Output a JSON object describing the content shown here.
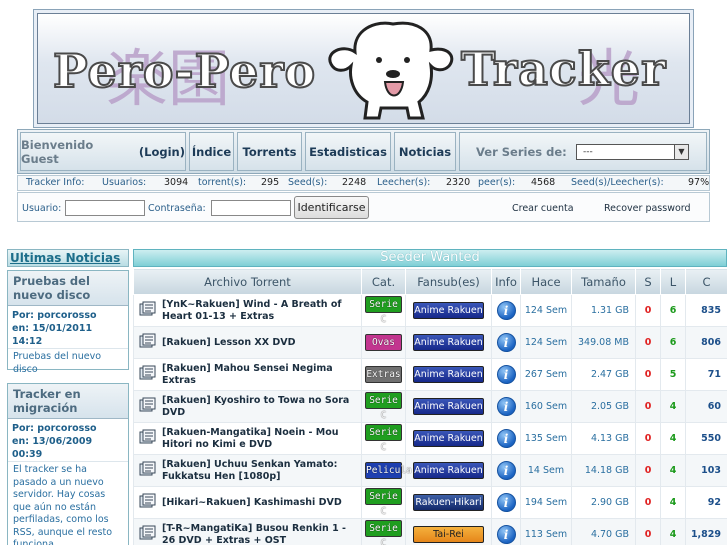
{
  "banner": {
    "word_left": "Pero-Pero",
    "word_right": "Tracker",
    "kanji_left": "楽園",
    "kanji_right": "光"
  },
  "nav": {
    "welcome": "Bienvenido Guest",
    "login_link": "(Login)",
    "items": [
      "Índice",
      "Torrents",
      "Estadisticas",
      "Noticias"
    ],
    "series_label": "Ver Series de:",
    "series_value": "---"
  },
  "stats": {
    "tracker_info": "Tracker Info:",
    "users_label": "Usuarios:",
    "users": "3094",
    "torrents_label": "torrent(s):",
    "torrents": "295",
    "seeds_label": "Seed(s):",
    "seeds": "2248",
    "leechers_label": "Leecher(s):",
    "leechers": "2320",
    "peers_label": "peer(s):",
    "peers": "4568",
    "ratio_label": "Seed(s)/Leecher(s):",
    "ratio": "97%"
  },
  "login": {
    "user_label": "Usuario:",
    "pass_label": "Contraseña:",
    "submit": "Identificarse",
    "create_account": "Crear cuenta",
    "recover": "Recover password"
  },
  "sidebar": {
    "title": "Ultimas Noticias",
    "news": [
      {
        "title": "Pruebas del nuevo disco",
        "author": "Por: porcorosso",
        "date": "en: 15/01/2011 14:12",
        "body": "Pruebas del nuevo disco"
      },
      {
        "title": "Tracker en migración",
        "author": "Por: porcorosso",
        "date": "en: 13/06/2009 00:39",
        "body": "El tracker se ha pasado a un nuevo servidor. Hay cosas que aún no están perfiladas, como los RSS, aunque el resto funciona."
      }
    ]
  },
  "main": {
    "title": "Seeder Wanted",
    "columns": [
      "Archivo Torrent",
      "Cat.",
      "Fansub(es)",
      "Info",
      "Hace",
      "Tamaño",
      "S",
      "L",
      "C"
    ],
    "rows": [
      {
        "name": "[YnK~Rakuen] Wind - A Breath of Heart 01-13 + Extras",
        "cat": "Serie C",
        "cat_color": "#1f9e1f",
        "fansub": "Anime Rakuen",
        "fansub_style": "rakuen",
        "hace": "124 Sem",
        "size": "1.31 GB",
        "s": "0",
        "l": "6",
        "c": "835"
      },
      {
        "name": "[Rakuen] Lesson XX DVD",
        "cat": "Ovas",
        "cat_color": "#c2358f",
        "fansub": "Anime Rakuen",
        "fansub_style": "rakuen",
        "hace": "124 Sem",
        "size": "349.08 MB",
        "s": "0",
        "l": "6",
        "c": "806"
      },
      {
        "name": "[Rakuen] Mahou Sensei Negima Extras",
        "cat": "Extras",
        "cat_color": "#707070",
        "fansub": "Anime Rakuen",
        "fansub_style": "rakuen",
        "hace": "267 Sem",
        "size": "2.47 GB",
        "s": "0",
        "l": "5",
        "c": "71"
      },
      {
        "name": "[Rakuen] Kyoshiro to Towa no Sora DVD",
        "cat": "Serie C",
        "cat_color": "#1f9e1f",
        "fansub": "Anime Rakuen",
        "fansub_style": "rakuen",
        "hace": "160 Sem",
        "size": "2.05 GB",
        "s": "0",
        "l": "4",
        "c": "60"
      },
      {
        "name": "[Rakuen-Mangatika] Noein - Mou Hitori no Kimi e DVD",
        "cat": "Serie C",
        "cat_color": "#1f9e1f",
        "fansub": "Anime Rakuen",
        "fansub_style": "rakuen",
        "hace": "135 Sem",
        "size": "4.13 GB",
        "s": "0",
        "l": "4",
        "c": "550"
      },
      {
        "name": "[Rakuen] Uchuu Senkan Yamato: Fukkatsu Hen [1080p]",
        "cat": "Pelicula",
        "cat_color": "#1e3fb0",
        "fansub": "Anime Rakuen",
        "fansub_style": "rakuen",
        "hace": "14 Sem",
        "size": "14.18 GB",
        "s": "0",
        "l": "4",
        "c": "103"
      },
      {
        "name": "[Hikari~Rakuen] Kashimashi DVD",
        "cat": "Serie C",
        "cat_color": "#1f9e1f",
        "fansub": "Rakuen-Hikari",
        "fansub_style": "hikari",
        "hace": "194 Sem",
        "size": "2.90 GB",
        "s": "0",
        "l": "4",
        "c": "92"
      },
      {
        "name": "[T-R~MangatiKa] Busou Renkin 1 - 26 DVD + Extras + OST",
        "cat": "Serie C",
        "cat_color": "#1f9e1f",
        "fansub": "Tai-Rei",
        "fansub_style": "tairei",
        "hace": "113 Sem",
        "size": "4.70 GB",
        "s": "0",
        "l": "4",
        "c": "1,829"
      }
    ]
  },
  "icons": {
    "file": "torrent-file-icon",
    "info": "info-icon",
    "dropdown": "chevron-down-icon"
  }
}
